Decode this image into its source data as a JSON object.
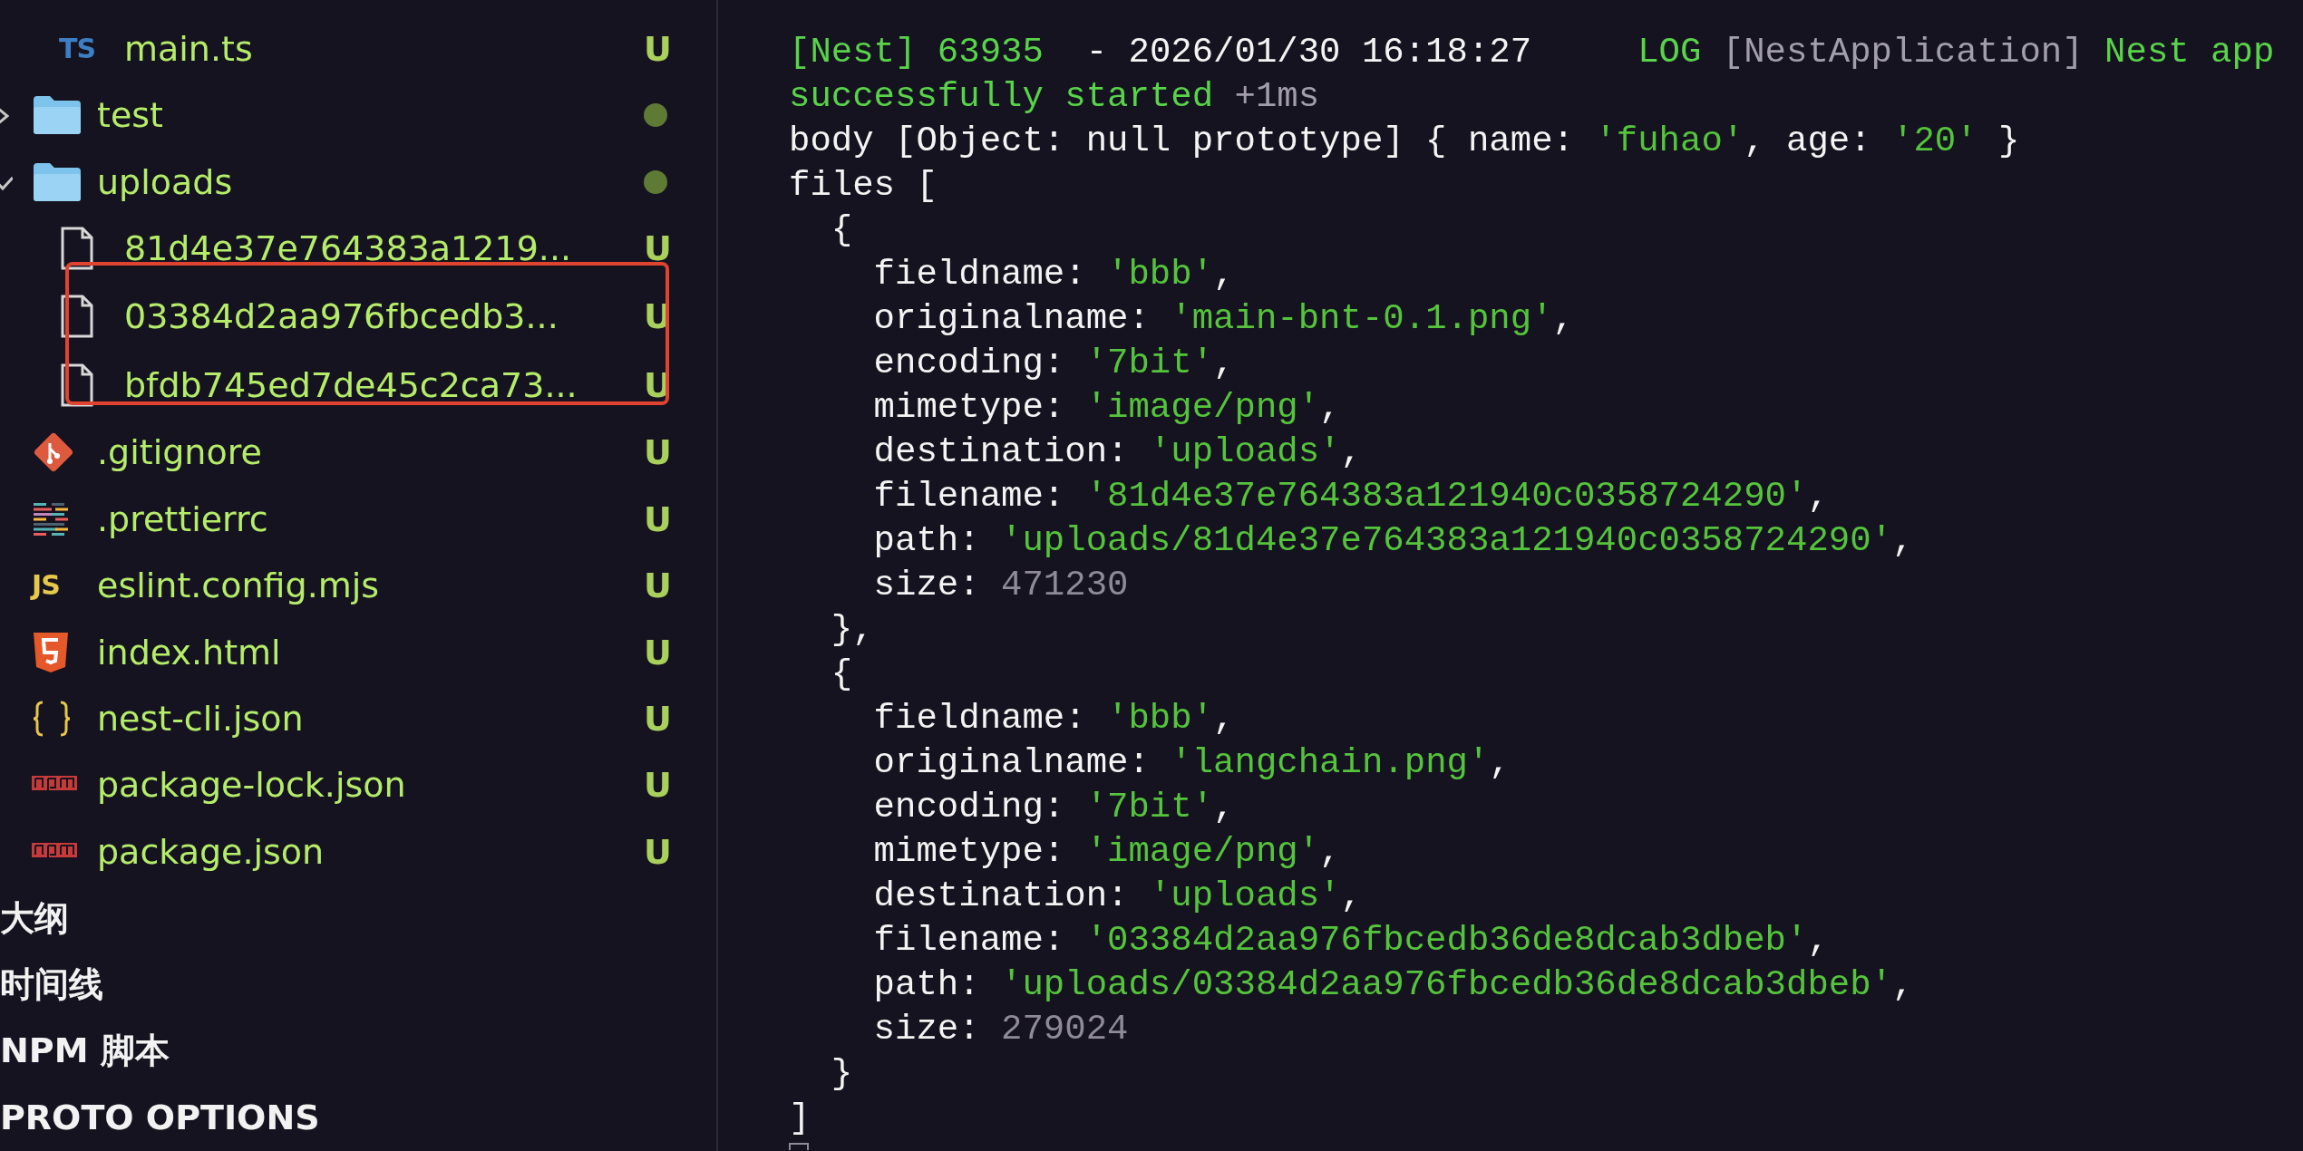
{
  "explorer": {
    "items": [
      {
        "children": [
          {
            "name": "main.ts",
            "kind": "typescript",
            "icon_text": "TS",
            "status": "U"
          }
        ]
      },
      {
        "name": "test",
        "kind": "folder",
        "expanded": false,
        "status_dot": true
      },
      {
        "name": "uploads",
        "kind": "folder",
        "expanded": true,
        "status_dot": true,
        "children": [
          {
            "name": "81d4e37e764383a1219...",
            "kind": "document",
            "status": "U"
          },
          {
            "name": "03384d2aa976fbcedb3...",
            "kind": "document",
            "status": "U",
            "highlighted": true
          },
          {
            "name": "bfdb745ed7de45c2ca73...",
            "kind": "document",
            "status": "U",
            "highlighted": true
          }
        ]
      },
      {
        "name": ".gitignore",
        "kind": "vcs",
        "status": "U"
      },
      {
        "name": ".prettierrc",
        "kind": "formatter",
        "status": "U"
      },
      {
        "name": "eslint.config.mjs",
        "kind": "javascript",
        "icon_text": "JS",
        "status": "U"
      },
      {
        "name": "index.html",
        "kind": "markup",
        "status": "U"
      },
      {
        "name": "nest-cli.json",
        "kind": "braces",
        "status": "U"
      },
      {
        "name": "package-lock.json",
        "kind": "package",
        "status": "U"
      },
      {
        "name": "package.json",
        "kind": "package",
        "status": "U"
      }
    ]
  },
  "sections": [
    "大纲",
    "时间线",
    "NPM 脚本",
    "PROTO OPTIONS"
  ],
  "terminal": {
    "lines": [
      [
        {
          "kind": "log",
          "text": "[Nest] 63935"
        },
        {
          "kind": "plain",
          "text": "  - 2026/01/30 16:18:27"
        },
        {
          "kind": "log",
          "text": "     LOG"
        },
        {
          "kind": "muted",
          "text": " [NestApplication]"
        },
        {
          "kind": "log",
          "text": " Nest app"
        }
      ],
      [
        {
          "kind": "log",
          "text": "successfully started"
        },
        {
          "kind": "muted",
          "text": " +1ms"
        }
      ],
      [
        {
          "kind": "plain",
          "text": "body [Object: null prototype] { name: "
        },
        {
          "kind": "string",
          "text": "'fuhao'"
        },
        {
          "kind": "plain",
          "text": ", age: "
        },
        {
          "kind": "string",
          "text": "'20'"
        },
        {
          "kind": "plain",
          "text": " }"
        }
      ],
      [
        {
          "kind": "plain",
          "text": "files ["
        }
      ],
      [
        {
          "kind": "plain",
          "text": "  {"
        }
      ],
      [
        {
          "kind": "plain",
          "text": "    fieldname: "
        },
        {
          "kind": "string",
          "text": "'bbb'"
        },
        {
          "kind": "plain",
          "text": ","
        }
      ],
      [
        {
          "kind": "plain",
          "text": "    originalname: "
        },
        {
          "kind": "string",
          "text": "'main-bnt-0.1.png'"
        },
        {
          "kind": "plain",
          "text": ","
        }
      ],
      [
        {
          "kind": "plain",
          "text": "    encoding: "
        },
        {
          "kind": "string",
          "text": "'7bit'"
        },
        {
          "kind": "plain",
          "text": ","
        }
      ],
      [
        {
          "kind": "plain",
          "text": "    mimetype: "
        },
        {
          "kind": "string",
          "text": "'image/png'"
        },
        {
          "kind": "plain",
          "text": ","
        }
      ],
      [
        {
          "kind": "plain",
          "text": "    destination: "
        },
        {
          "kind": "string",
          "text": "'uploads'"
        },
        {
          "kind": "plain",
          "text": ","
        }
      ],
      [
        {
          "kind": "plain",
          "text": "    filename: "
        },
        {
          "kind": "string",
          "text": "'81d4e37e764383a121940c0358724290'"
        },
        {
          "kind": "plain",
          "text": ","
        }
      ],
      [
        {
          "kind": "plain",
          "text": "    path: "
        },
        {
          "kind": "string",
          "text": "'uploads/81d4e37e764383a121940c0358724290'"
        },
        {
          "kind": "plain",
          "text": ","
        }
      ],
      [
        {
          "kind": "plain",
          "text": "    size: "
        },
        {
          "kind": "number",
          "text": "471230"
        }
      ],
      [
        {
          "kind": "plain",
          "text": "  },"
        }
      ],
      [
        {
          "kind": "plain",
          "text": "  {"
        }
      ],
      [
        {
          "kind": "plain",
          "text": "    fieldname: "
        },
        {
          "kind": "string",
          "text": "'bbb'"
        },
        {
          "kind": "plain",
          "text": ","
        }
      ],
      [
        {
          "kind": "plain",
          "text": "    originalname: "
        },
        {
          "kind": "string",
          "text": "'langchain.png'"
        },
        {
          "kind": "plain",
          "text": ","
        }
      ],
      [
        {
          "kind": "plain",
          "text": "    encoding: "
        },
        {
          "kind": "string",
          "text": "'7bit'"
        },
        {
          "kind": "plain",
          "text": ","
        }
      ],
      [
        {
          "kind": "plain",
          "text": "    mimetype: "
        },
        {
          "kind": "string",
          "text": "'image/png'"
        },
        {
          "kind": "plain",
          "text": ","
        }
      ],
      [
        {
          "kind": "plain",
          "text": "    destination: "
        },
        {
          "kind": "string",
          "text": "'uploads'"
        },
        {
          "kind": "plain",
          "text": ","
        }
      ],
      [
        {
          "kind": "plain",
          "text": "    filename: "
        },
        {
          "kind": "string",
          "text": "'03384d2aa976fbcedb36de8dcab3dbeb'"
        },
        {
          "kind": "plain",
          "text": ","
        }
      ],
      [
        {
          "kind": "plain",
          "text": "    path: "
        },
        {
          "kind": "string",
          "text": "'uploads/03384d2aa976fbcedb36de8dcab3dbeb'"
        },
        {
          "kind": "plain",
          "text": ","
        }
      ],
      [
        {
          "kind": "plain",
          "text": "    size: "
        },
        {
          "kind": "number",
          "text": "279024"
        }
      ],
      [
        {
          "kind": "plain",
          "text": "  }"
        }
      ],
      [
        {
          "kind": "plain",
          "text": "]"
        }
      ]
    ]
  }
}
